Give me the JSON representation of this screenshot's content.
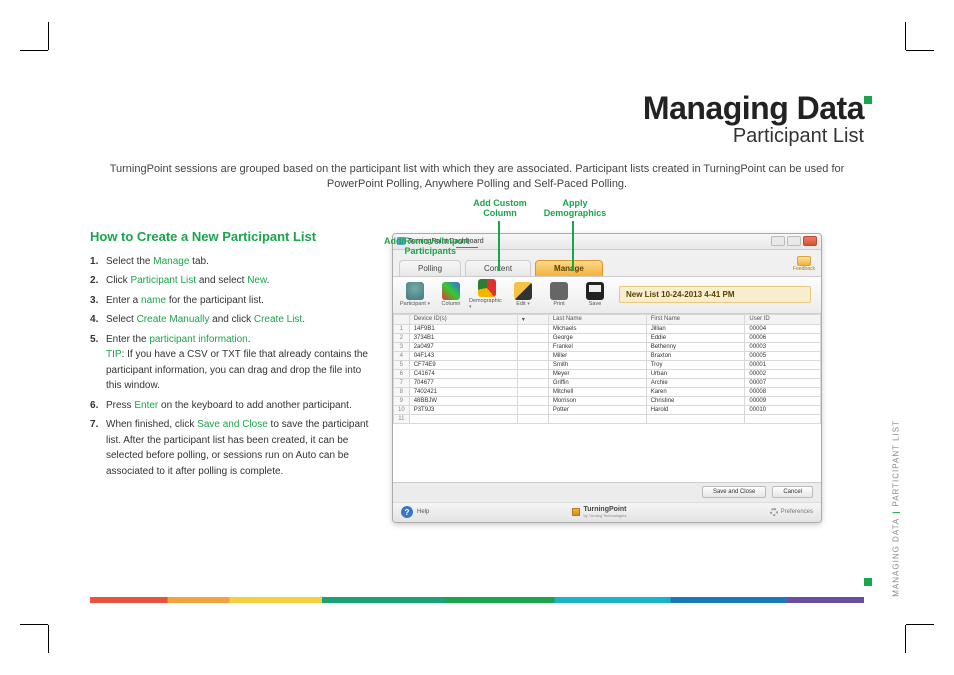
{
  "header": {
    "title": "Managing Data",
    "subtitle": "Participant List",
    "intro": "TurningPoint sessions are grouped based on the participant list with which they are associated.  Participant lists created in TurningPoint can be used for PowerPoint Polling, Anywhere Polling and Self-Paced Polling."
  },
  "section": {
    "title": "How to Create a New Participant List"
  },
  "steps": {
    "s1a": "Select the ",
    "s1b": "Manage",
    "s1c": " tab.",
    "s2a": "Click ",
    "s2b": "Participant List",
    "s2c": " and select ",
    "s2d": "New",
    "s2e": ".",
    "s3a": "Enter a ",
    "s3b": "name",
    "s3c": " for the participant list.",
    "s4a": "Select ",
    "s4b": "Create Manually",
    "s4c": " and click ",
    "s4d": "Create List",
    "s4e": ".",
    "s5a": "Enter the ",
    "s5b": "participant information",
    "s5c": ".",
    "s5tipa": "TIP",
    "s5tipb": ": If you have a CSV or TXT file that already contains the participant information, you can drag and drop the file into this window.",
    "s6a": "Press ",
    "s6b": "Enter",
    "s6c": " on the keyboard to add another participant.",
    "s7a": "When finished, click ",
    "s7b": "Save and Close",
    "s7c": " to save the participant list.  After the participant list has been created, it can be selected before polling, or sessions run on Auto can be associated to it after polling is complete."
  },
  "callouts": {
    "participants": "Add/Remove/Import Participants",
    "column": "Add Custom Column",
    "demographics": "Apply Demographics"
  },
  "win": {
    "title": "TurningPoint Dashboard",
    "tabs": {
      "polling": "Polling",
      "content": "Content",
      "manage": "Manage"
    },
    "feedback": "Feedback",
    "toolbar": {
      "participant": "Participant",
      "column": "Column",
      "demographic": "Demographic",
      "edit": "Edit",
      "print": "Print",
      "save": "Save"
    },
    "listname": "New List 10-24-2013 4-41 PM",
    "columns": {
      "rownum": "",
      "device": "Device ID(s)",
      "last": "Last Name",
      "first": "First Name",
      "user": "User ID"
    },
    "rows": [
      {
        "n": "1",
        "d": "14F9B1",
        "l": "Michaels",
        "f": "Jillian",
        "u": "00004"
      },
      {
        "n": "2",
        "d": "3734B1",
        "l": "George",
        "f": "Eddie",
        "u": "00006"
      },
      {
        "n": "3",
        "d": "2a0497",
        "l": "Frankel",
        "f": "Bethenny",
        "u": "00003"
      },
      {
        "n": "4",
        "d": "04F143",
        "l": "Miller",
        "f": "Braxton",
        "u": "00005"
      },
      {
        "n": "5",
        "d": "CF74E9",
        "l": "Smith",
        "f": "Troy",
        "u": "00001"
      },
      {
        "n": "6",
        "d": "C41674",
        "l": "Meyer",
        "f": "Urban",
        "u": "00002"
      },
      {
        "n": "7",
        "d": "704677",
        "l": "Griffin",
        "f": "Archie",
        "u": "00007"
      },
      {
        "n": "8",
        "d": "7402421",
        "l": "Mitchell",
        "f": "Karen",
        "u": "00008"
      },
      {
        "n": "9",
        "d": "48BBJW",
        "l": "Morrison",
        "f": "Christine",
        "u": "00009"
      },
      {
        "n": "10",
        "d": "P3T9J3",
        "l": "Potter",
        "f": "Harold",
        "u": "00010"
      },
      {
        "n": "11",
        "d": "",
        "l": "",
        "f": "",
        "u": ""
      }
    ],
    "footer": {
      "save": "Save and Close",
      "cancel": "Cancel",
      "help": "Help",
      "brand": "TurningPoint",
      "tagline": "by Turning Technologies",
      "prefs": "Preferences"
    }
  },
  "side": {
    "managing": "MANAGING DATA",
    "participant": "PARTICIPANT LIST"
  }
}
